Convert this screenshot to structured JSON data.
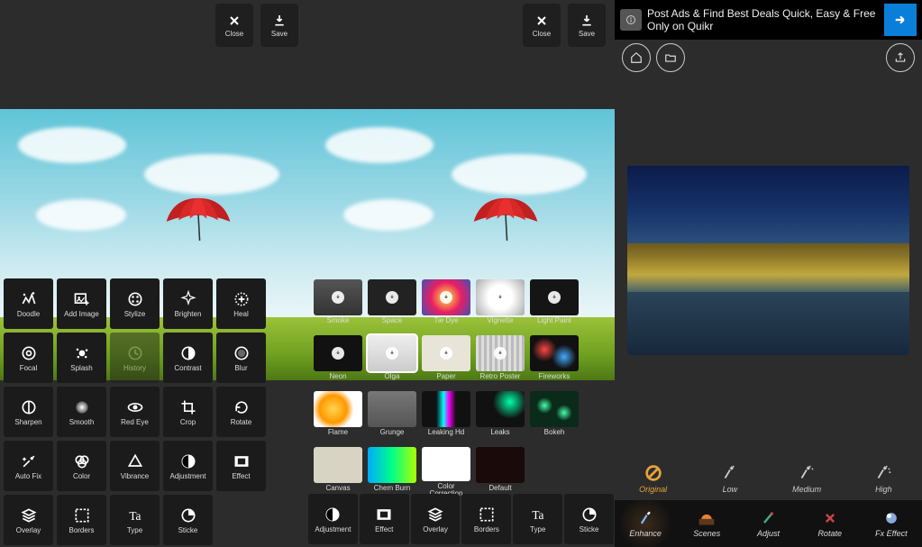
{
  "left": {
    "topbar": {
      "close": "Close",
      "save": "Save"
    },
    "tools": [
      {
        "id": "doodle",
        "label": "Doodle"
      },
      {
        "id": "add-image",
        "label": "Add Image"
      },
      {
        "id": "stylize",
        "label": "Stylize"
      },
      {
        "id": "brighten",
        "label": "Brighten"
      },
      {
        "id": "heal",
        "label": "Heal"
      },
      {
        "id": "focal",
        "label": "Focal"
      },
      {
        "id": "splash",
        "label": "Splash"
      },
      {
        "id": "history",
        "label": "History",
        "disabled": true
      },
      {
        "id": "contrast",
        "label": "Contrast"
      },
      {
        "id": "blur",
        "label": "Blur"
      },
      {
        "id": "sharpen",
        "label": "Sharpen"
      },
      {
        "id": "smooth",
        "label": "Smooth"
      },
      {
        "id": "red-eye",
        "label": "Red Eye"
      },
      {
        "id": "crop",
        "label": "Crop"
      },
      {
        "id": "rotate",
        "label": "Rotate"
      },
      {
        "id": "auto-fix",
        "label": "Auto Fix"
      },
      {
        "id": "color",
        "label": "Color"
      },
      {
        "id": "vibrance",
        "label": "Vibrance"
      },
      {
        "id": "adjustment",
        "label": "Adjustment"
      },
      {
        "id": "effect",
        "label": "Effect"
      },
      {
        "id": "overlay",
        "label": "Overlay"
      },
      {
        "id": "borders",
        "label": "Borders"
      },
      {
        "id": "type",
        "label": "Type"
      },
      {
        "id": "sticker",
        "label": "Sticke"
      }
    ]
  },
  "mid": {
    "topbar": {
      "close": "Close",
      "save": "Save"
    },
    "effects": [
      {
        "id": "smoke",
        "label": "Smoke",
        "bg": "linear-gradient(#555,#333)"
      },
      {
        "id": "space",
        "label": "Space",
        "bg": "#222"
      },
      {
        "id": "tie-dye",
        "label": "Tie Dye",
        "bg": "radial-gradient(circle,#ffeb3b,#e91e63,#3f51b5)"
      },
      {
        "id": "vignette",
        "label": "Vignette",
        "bg": "radial-gradient(circle,#fff 40%,#aaa 100%)"
      },
      {
        "id": "light-paint",
        "label": "Light Paint",
        "bg": "#151515"
      },
      {
        "id": "neon",
        "label": "Neon",
        "bg": "#111"
      },
      {
        "id": "olga",
        "label": "Olga",
        "bg": "linear-gradient(#eee,#ccc)",
        "selected": true
      },
      {
        "id": "paper",
        "label": "Paper",
        "bg": "#e8e4d8"
      },
      {
        "id": "retro-poster",
        "label": "Retro Poster",
        "bg": "repeating-linear-gradient(90deg,#ddd 0 3px,#bbb 3px 6px)"
      },
      {
        "id": "fireworks",
        "label": "Fireworks",
        "bg": "radial-gradient(circle at 30% 40%,#f44,transparent 30%),radial-gradient(circle at 70% 60%,#4af,transparent 30%),#111",
        "nodl": true
      },
      {
        "id": "flame",
        "label": "Flame",
        "bg": "radial-gradient(circle at 40% 50%,#ffd54f,#ff9800 40%,#fff 60%)",
        "nodl": true
      },
      {
        "id": "grunge",
        "label": "Grunge",
        "bg": "linear-gradient(#777,#555)",
        "nodl": true
      },
      {
        "id": "leaking-hd",
        "label": "Leaking Hd",
        "bg": "linear-gradient(90deg,#111 30%,#0ff 45%,#f0f 55%,#111 70%)",
        "nodl": true
      },
      {
        "id": "leaks",
        "label": "Leaks",
        "bg": "radial-gradient(circle at 70% 30%,#0fa,transparent 40%),#111",
        "nodl": true
      },
      {
        "id": "bokeh",
        "label": "Bokeh",
        "bg": "radial-gradient(circle at 30% 40%,#4fa,transparent 20%),radial-gradient(circle at 70% 60%,#4fa,transparent 20%),#0a2a1a",
        "nodl": true
      },
      {
        "id": "canvas",
        "label": "Canvas",
        "bg": "#d8d4c4",
        "nodl": true
      },
      {
        "id": "chem-burn",
        "label": "Chem Burn",
        "bg": "linear-gradient(90deg,#0af,#0f8,#af0)",
        "nodl": true
      },
      {
        "id": "color-correction",
        "label": "Color Correction",
        "bg": "#fff",
        "nodl": true
      },
      {
        "id": "default",
        "label": "Default",
        "bg": "#1a0a0a",
        "nodl": true
      }
    ],
    "bottom": [
      {
        "id": "adjustment",
        "label": "Adjustment"
      },
      {
        "id": "effect",
        "label": "Effect"
      },
      {
        "id": "overlay",
        "label": "Overlay"
      },
      {
        "id": "borders",
        "label": "Borders"
      },
      {
        "id": "type",
        "label": "Type"
      },
      {
        "id": "sticker",
        "label": "Sticke"
      }
    ]
  },
  "right": {
    "ad": {
      "text": "Post Ads & Find Best Deals Quick, Easy & Free Only on Quikr"
    },
    "levels": [
      {
        "id": "original",
        "label": "Original",
        "active": true
      },
      {
        "id": "low",
        "label": "Low"
      },
      {
        "id": "medium",
        "label": "Medium"
      },
      {
        "id": "high",
        "label": "High"
      }
    ],
    "tabs": [
      {
        "id": "enhance",
        "label": "Enhance",
        "active": true
      },
      {
        "id": "scenes",
        "label": "Scenes"
      },
      {
        "id": "adjust",
        "label": "Adjust"
      },
      {
        "id": "rotate",
        "label": "Rotate"
      },
      {
        "id": "fx-effect",
        "label": "Fx Effect"
      }
    ]
  }
}
